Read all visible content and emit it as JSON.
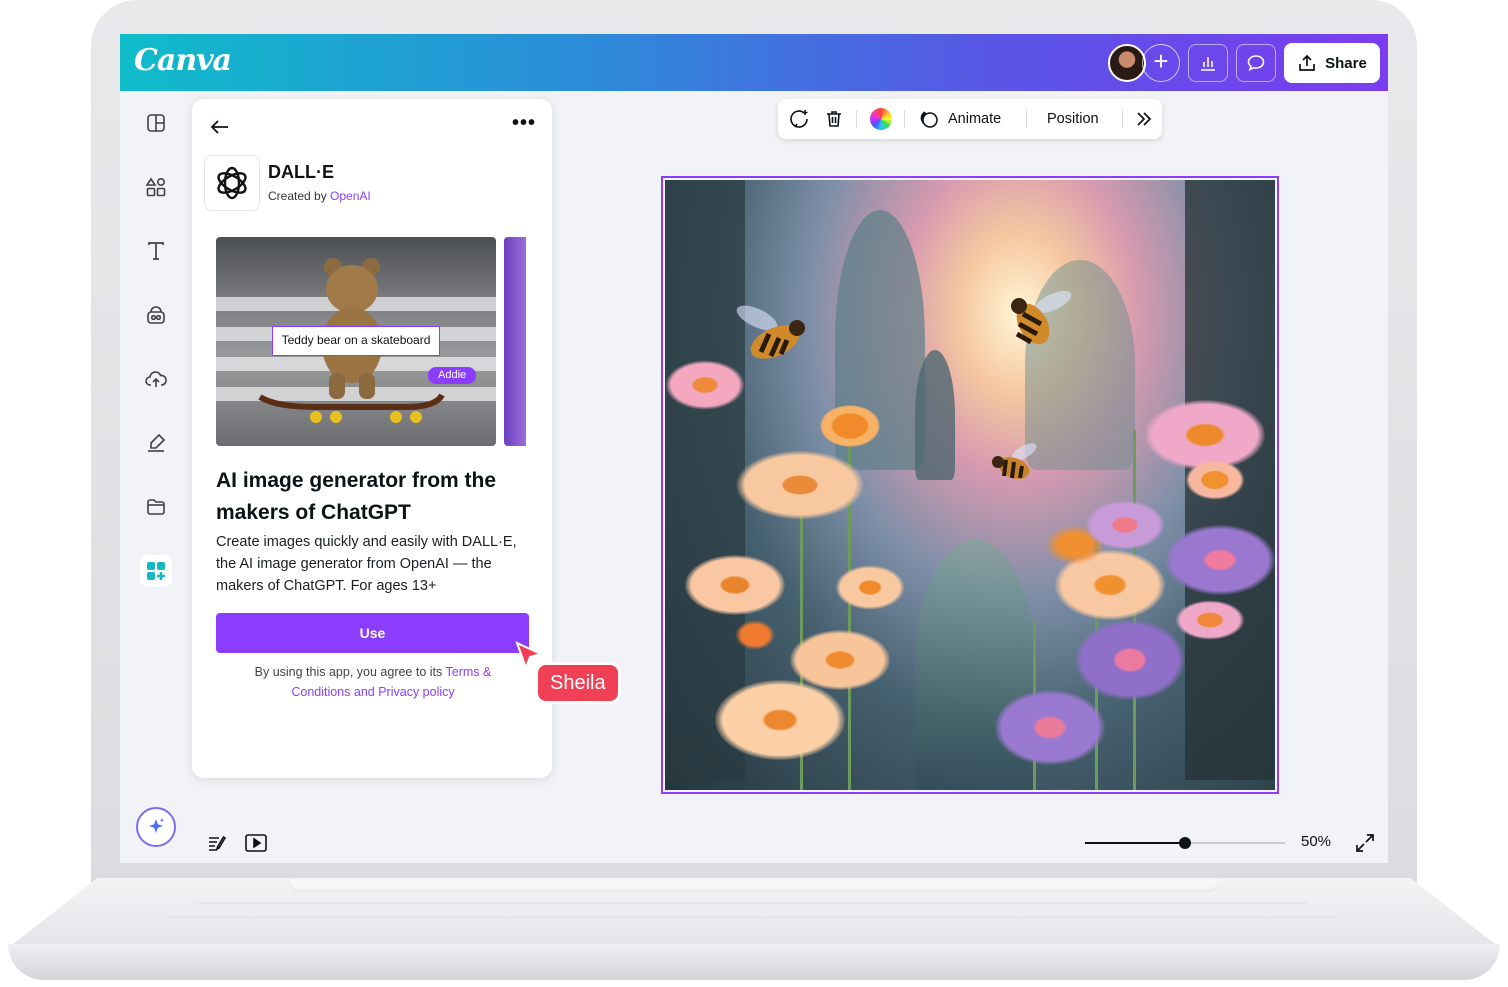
{
  "app": {
    "logo": "Canva",
    "share_label": "Share"
  },
  "panel": {
    "app_name": "DALL·E",
    "created_by_prefix": "Created by ",
    "created_by_link": "OpenAI",
    "preview_prompt": "Teddy bear on a skateboard",
    "preview_cursor_name": "Addie",
    "title": "AI image generator from the makers of ChatGPT",
    "description": "Create images quickly and easily with DALL·E, the AI image generator from OpenAI — the makers of ChatGPT. For ages 13+",
    "use_label": "Use",
    "terms_prefix": "By using this app, you agree to its ",
    "terms_link": "Terms & Conditions and Privacy policy"
  },
  "collaborator": {
    "name": "Sheila",
    "color": "#ef4056"
  },
  "context_toolbar": {
    "animate_label": "Animate",
    "position_label": "Position"
  },
  "zoom": {
    "label": "50%",
    "level": 0.5
  },
  "colors": {
    "accent": "#8b3dff",
    "header_gradient": [
      "#0fbcca",
      "#5a54e6",
      "#7b3cf0"
    ]
  }
}
